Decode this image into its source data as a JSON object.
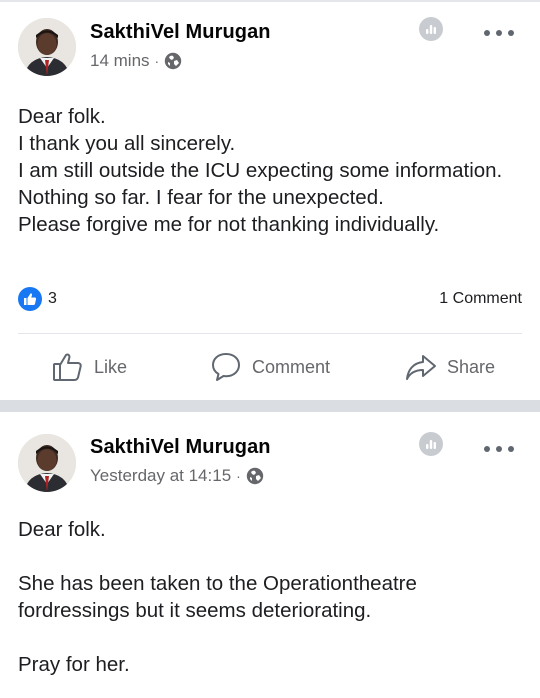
{
  "posts": [
    {
      "author": "SakthiVel Murugan",
      "time": "14 mins",
      "dot": "·",
      "paragraphs": [
        "Dear folk.\nI thank you all sincerely.\nI am still outside the ICU expecting some information. Nothing so far. I fear for the unexpected.\nPlease forgive me for not thanking individually."
      ],
      "reaction_count": "3",
      "comment_count": "1 Comment",
      "actions": {
        "like": "Like",
        "comment": "Comment",
        "share": "Share"
      }
    },
    {
      "author": "SakthiVel Murugan",
      "time": "Yesterday at 14:15",
      "dot": "·",
      "paragraphs": [
        "Dear folk.\n\nShe has been taken to the Operationtheatre fordressings but it seems deteriorating.\n\nPray for her."
      ]
    }
  ],
  "colors": {
    "accent": "#1877f2",
    "muted": "#65676b",
    "icon_gray": "#606770",
    "separator": "#dadde1"
  },
  "icons": [
    "insights-icon",
    "more-icon",
    "globe-icon",
    "like-icon",
    "comment-icon",
    "share-icon",
    "like-reaction-icon"
  ]
}
